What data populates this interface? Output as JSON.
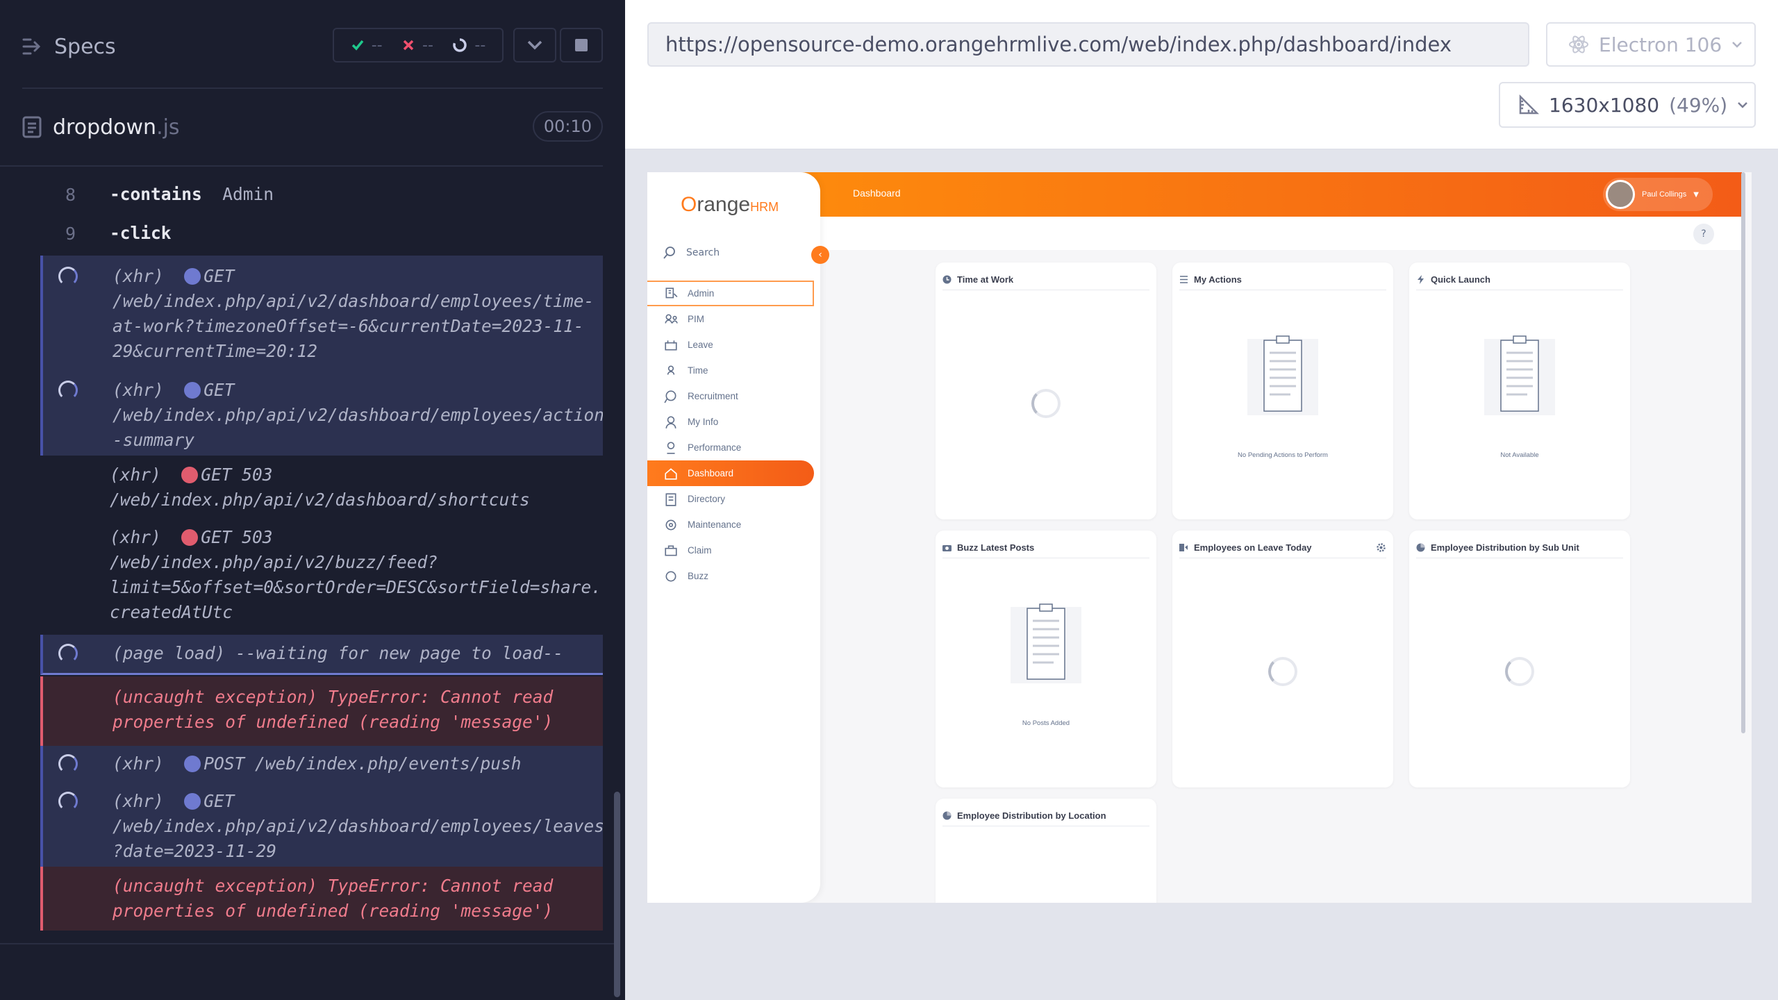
{
  "reporter": {
    "header_title": "Specs",
    "stats": {
      "passed": "--",
      "failed": "--",
      "pending": "--"
    },
    "spec_file": {
      "name": "dropdown",
      "ext": ".js",
      "duration": "00:10"
    },
    "commands": [
      {
        "num": "8",
        "text": "-contains  Admin"
      },
      {
        "num": "9",
        "text": "-click"
      },
      {
        "lines": [
          "(xhr)  GET",
          "/web/index.php/api/v2/dashboard/employees/time-",
          "at-work?timezoneOffset=-6&currentDate=2023-11-",
          "29&currentTime=20:12"
        ]
      },
      {
        "lines": [
          "(xhr)  GET",
          "/web/index.php/api/v2/dashboard/employees/action",
          "-summary"
        ]
      },
      {
        "lines": [
          "(xhr)  GET 503",
          "/web/index.php/api/v2/dashboard/shortcuts"
        ]
      },
      {
        "lines": [
          "(xhr)  GET 503",
          "/web/index.php/api/v2/buzz/feed?",
          "limit=5&offset=0&sortOrder=DESC&sortField=share.",
          "createdAtUtc"
        ]
      },
      {
        "lines": [
          "(page load)  --waiting for new page to load--"
        ]
      },
      {
        "lines": [
          "(uncaught exception)  TypeError: Cannot read",
          "properties of undefined (reading 'message')"
        ]
      },
      {
        "lines": [
          "(xhr)  POST /web/index.php/events/push"
        ]
      },
      {
        "lines": [
          "(xhr)  GET",
          "/web/index.php/api/v2/dashboard/employees/leaves",
          "?date=2023-11-29"
        ]
      },
      {
        "lines": [
          "(uncaught exception)  TypeError: Cannot read",
          "properties of undefined (reading 'message')"
        ]
      }
    ]
  },
  "aut": {
    "url": "https://opensource-demo.orangehrmlive.com/web/index.php/dashboard/index",
    "browser": "Electron 106",
    "viewport": "1630x1080",
    "scale": "(49%)"
  },
  "app": {
    "logo_prefix": "range",
    "logo_hrm": "HRM",
    "search_label": "Search",
    "collapse_icon": "‹",
    "page_title": "Dashboard",
    "user_name": "Paul Collings",
    "help_label": "?",
    "nav": [
      "Admin",
      "PIM",
      "Leave",
      "Time",
      "Recruitment",
      "My Info",
      "Performance",
      "Dashboard",
      "Directory",
      "Maintenance",
      "Claim",
      "Buzz"
    ],
    "widgets": {
      "time_at_work": "Time at Work",
      "my_actions": "My Actions",
      "my_actions_empty": "No Pending Actions to Perform",
      "quick_launch": "Quick Launch",
      "quick_launch_empty": "Not Available",
      "buzz": "Buzz Latest Posts",
      "buzz_empty": "No Posts Added",
      "leave_today": "Employees on Leave Today",
      "dist_subunit": "Employee Distribution by Sub Unit",
      "dist_location": "Employee Distribution by Location"
    }
  },
  "colors": {
    "accent": "#ff7b1d",
    "reporter_bg": "#1b1e2e",
    "pending": "#6f7ad0",
    "error": "#e05c6e"
  }
}
